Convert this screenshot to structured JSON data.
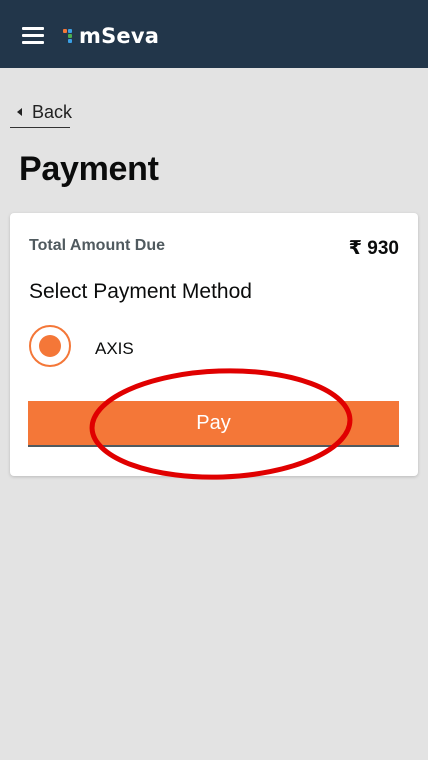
{
  "header": {
    "app_name": "mSeva",
    "menu_icon": "hamburger-menu-icon",
    "background": "#22364a"
  },
  "nav": {
    "back_label": "Back",
    "back_icon": "caret-left-icon"
  },
  "page": {
    "title": "Payment"
  },
  "payment": {
    "total_label": "Total Amount Due",
    "total_value": "₹ 930",
    "method_title": "Select Payment Method",
    "methods": [
      {
        "label": "AXIS",
        "selected": true
      }
    ],
    "pay_label": "Pay",
    "accent_color": "#f47738"
  },
  "annotation": {
    "type": "red-ellipse",
    "target": "pay-button",
    "color": "#e00000"
  }
}
